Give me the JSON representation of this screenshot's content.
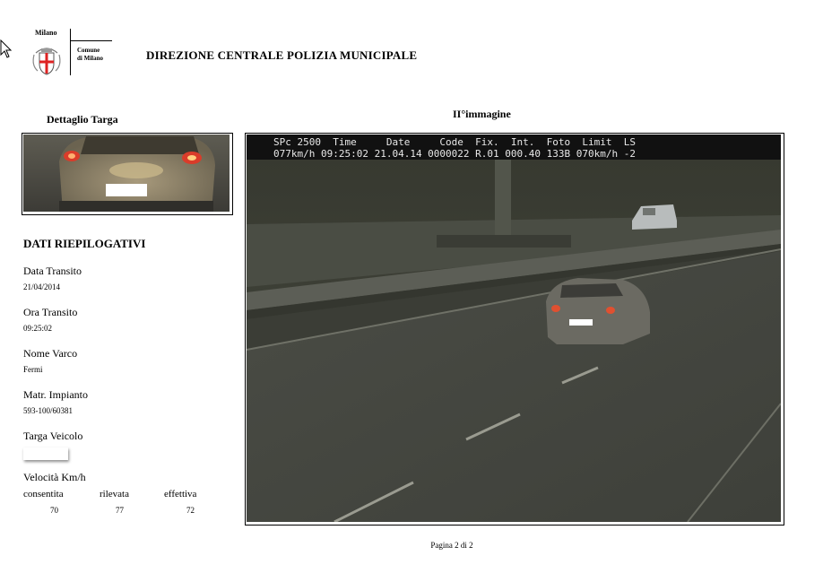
{
  "header": {
    "city": "Milano",
    "comune_line1": "Comune",
    "comune_line2": "di Milano",
    "title": "DIREZIONE CENTRALE POLIZIA MUNICIPALE"
  },
  "plate_section": {
    "title": "Dettaglio Targa"
  },
  "image_section": {
    "title": "II°immagine",
    "overlay_row1": "SPc 2500  Time     Date     Code  Fix.  Int.  Foto  Limit  LS",
    "overlay_row2": "077km/h 09:25:02 21.04.14 0000022 R.01 000.40 133B 070km/h -2"
  },
  "summary": {
    "title": "DATI RIEPILOGATIVI",
    "data_transito_label": "Data Transito",
    "data_transito_value": "21/04/2014",
    "ora_transito_label": "Ora Transito",
    "ora_transito_value": "09:25:02",
    "nome_varco_label": "Nome Varco",
    "nome_varco_value": "Fermi",
    "matr_impianto_label": "Matr. Impianto",
    "matr_impianto_value": "593-100/60381",
    "targa_veicolo_label": "Targa Veicolo",
    "velocita_label": "Velocità Km/h",
    "consentita_label": "consentita",
    "rilevata_label": "rilevata",
    "effettiva_label": "effettiva",
    "consentita_value": "70",
    "rilevata_value": "77",
    "effettiva_value": "72"
  },
  "footer": {
    "page": "Pagina 2 di 2"
  },
  "icons": [
    "cursor-arrow-icon",
    "milano-crest-icon"
  ]
}
